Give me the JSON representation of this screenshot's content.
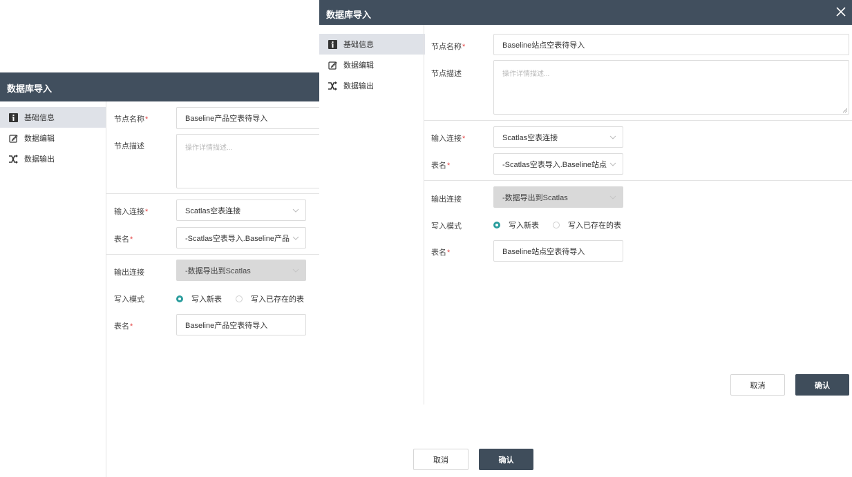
{
  "back_dialog": {
    "title": "数据库导入",
    "sidebar": [
      {
        "label": "基础信息",
        "icon": "info-icon",
        "active": true
      },
      {
        "label": "数据编辑",
        "icon": "edit-icon",
        "active": false
      },
      {
        "label": "数据输出",
        "icon": "shuffle-icon",
        "active": false
      }
    ],
    "form": {
      "node_name_label": "节点名称",
      "node_name_value": "Baseline产品空表待导入",
      "node_desc_label": "节点描述",
      "node_desc_placeholder": "操作详情描述...",
      "input_conn_label": "输入连接",
      "input_conn_value": "Scatlas空表连接",
      "table_label": "表名",
      "table_value": "-Scatlas空表导入.Baseline产品",
      "output_conn_label": "输出连接",
      "output_conn_value": "-数据导出到Scatlas",
      "write_mode_label": "写入模式",
      "write_new": "写入新表",
      "write_existing": "写入已存在的表",
      "out_table_label": "表名",
      "out_table_value": "Baseline产品空表待导入"
    },
    "cancel": "取消",
    "confirm": "确认"
  },
  "front_dialog": {
    "title": "数据库导入",
    "close_icon": "close-icon",
    "sidebar": [
      {
        "label": "基础信息",
        "icon": "info-icon",
        "active": true
      },
      {
        "label": "数据编辑",
        "icon": "edit-icon",
        "active": false
      },
      {
        "label": "数据输出",
        "icon": "shuffle-icon",
        "active": false
      }
    ],
    "form": {
      "node_name_label": "节点名称",
      "node_name_value": "Baseline站点空表待导入",
      "node_desc_label": "节点描述",
      "node_desc_placeholder": "操作详情描述...",
      "input_conn_label": "输入连接",
      "input_conn_value": "Scatlas空表连接",
      "table_label": "表名",
      "table_value": "-Scatlas空表导入.Baseline站点",
      "output_conn_label": "输出连接",
      "output_conn_value": "-数据导出到Scatlas",
      "write_mode_label": "写入模式",
      "write_new": "写入新表",
      "write_existing": "写入已存在的表",
      "out_table_label": "表名",
      "out_table_value": "Baseline站点空表待导入"
    },
    "cancel": "取消",
    "confirm": "确认"
  },
  "colors": {
    "header": "#414f5e",
    "accent": "#2a9d9d",
    "required": "#e54545",
    "active_item": "#dfe2e8"
  }
}
